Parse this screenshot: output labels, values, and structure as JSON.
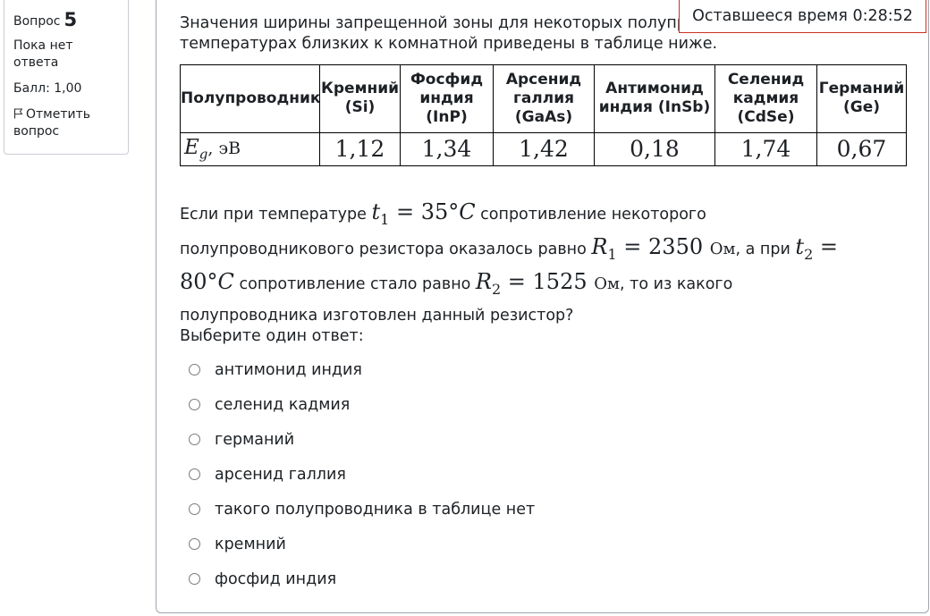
{
  "info": {
    "question_label": "Вопрос",
    "question_number": "5",
    "state": "Пока нет ответа",
    "grade": "Балл: 1,00",
    "flag_label": "Отметить вопрос"
  },
  "timer": {
    "text": "Оставшееся время 0:28:52"
  },
  "question": {
    "intro_line1": "Значения ширины запрещенной зоны для некоторых полупроводников при",
    "intro_line2": "температурах близких к комнатной приведены в таблице ниже.",
    "table": {
      "header_first": "Полупроводник",
      "columns": [
        "Кремний (Si)",
        "Фосфид индия (InP)",
        "Арсенид галлия (GaAs)",
        "Антимонид индия (InSb)",
        "Селенид кадмия (CdSe)",
        "Германий (Ge)"
      ],
      "row_symbol": "E",
      "row_subscript": "g",
      "row_unit": ",  эВ",
      "values": [
        "1,12",
        "1,34",
        "1,42",
        "0,18",
        "1,74",
        "0,67"
      ]
    },
    "problem": {
      "text_a": "Если при температуре ",
      "t1_symbol": "t",
      "t1_sub": "1",
      "t1_value": " = 35°",
      "t1_unit": "C",
      "text_b": " сопротивление некоторого полупроводникового резистора оказалось равно ",
      "r1_symbol": "R",
      "r1_sub": "1",
      "r1_value": " = 2350 ",
      "r1_unit": "Ом",
      "text_c": ", а при ",
      "t2_symbol": "t",
      "t2_sub": "2",
      "t2_value": " = 80°",
      "t2_unit": "C",
      "text_d": " сопротивление стало равно ",
      "r2_symbol": "R",
      "r2_sub": "2",
      "r2_value": " = 1525 ",
      "r2_unit": "Ом",
      "text_e": ", то из какого полупроводника изготовлен данный резистор?"
    },
    "prompt": "Выберите один ответ:",
    "options": [
      "антимонид индия",
      "селенид кадмия",
      "германий",
      "арсенид галлия",
      "такого полупроводника в таблице нет",
      "кремний",
      "фосфид индия"
    ]
  },
  "colors": {
    "timer_border": "#ca3120",
    "panel_border": "#9fa6ad"
  },
  "icons": {
    "flag": "flag-icon",
    "radio": "radio-icon"
  }
}
